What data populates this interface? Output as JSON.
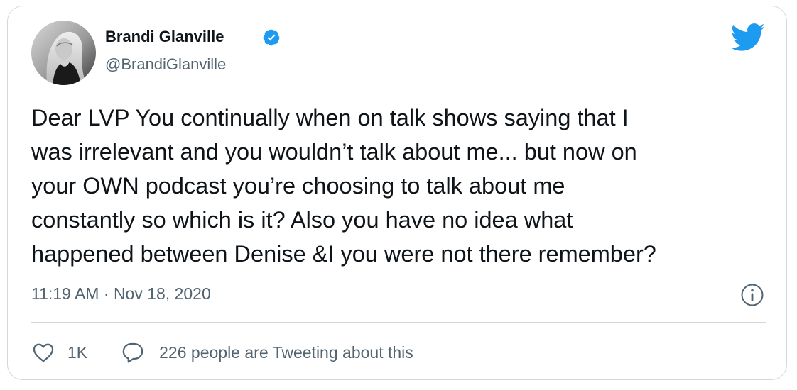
{
  "author": {
    "name": "Brandi Glanville",
    "handle": "@BrandiGlanville",
    "verified": true,
    "avatar_icon": "profile-photo"
  },
  "tweet": {
    "lines": [
      "Dear LVP You continually when on talk  shows saying that I",
      "was irrelevant and you wouldn’t talk about me... but now on",
      "your OWN podcast you’re choosing to talk about me",
      "constantly so which is it? Also you have no idea what",
      "happened between Denise &I you were not there remember?"
    ],
    "time": "11:19 AM",
    "separator": " · ",
    "date": "Nov 18, 2020"
  },
  "actions": {
    "like_count": "1K",
    "conversation_text": "226 people are Tweeting about this"
  },
  "icons": {
    "brand": "twitter-bird-icon",
    "verified": "verified-badge-icon",
    "info": "info-icon",
    "like": "heart-icon",
    "reply": "speech-bubble-icon"
  },
  "colors": {
    "brand_blue": "#1d9bf0",
    "text": "#0f1419",
    "muted": "#536471",
    "border": "#cfd9de"
  }
}
